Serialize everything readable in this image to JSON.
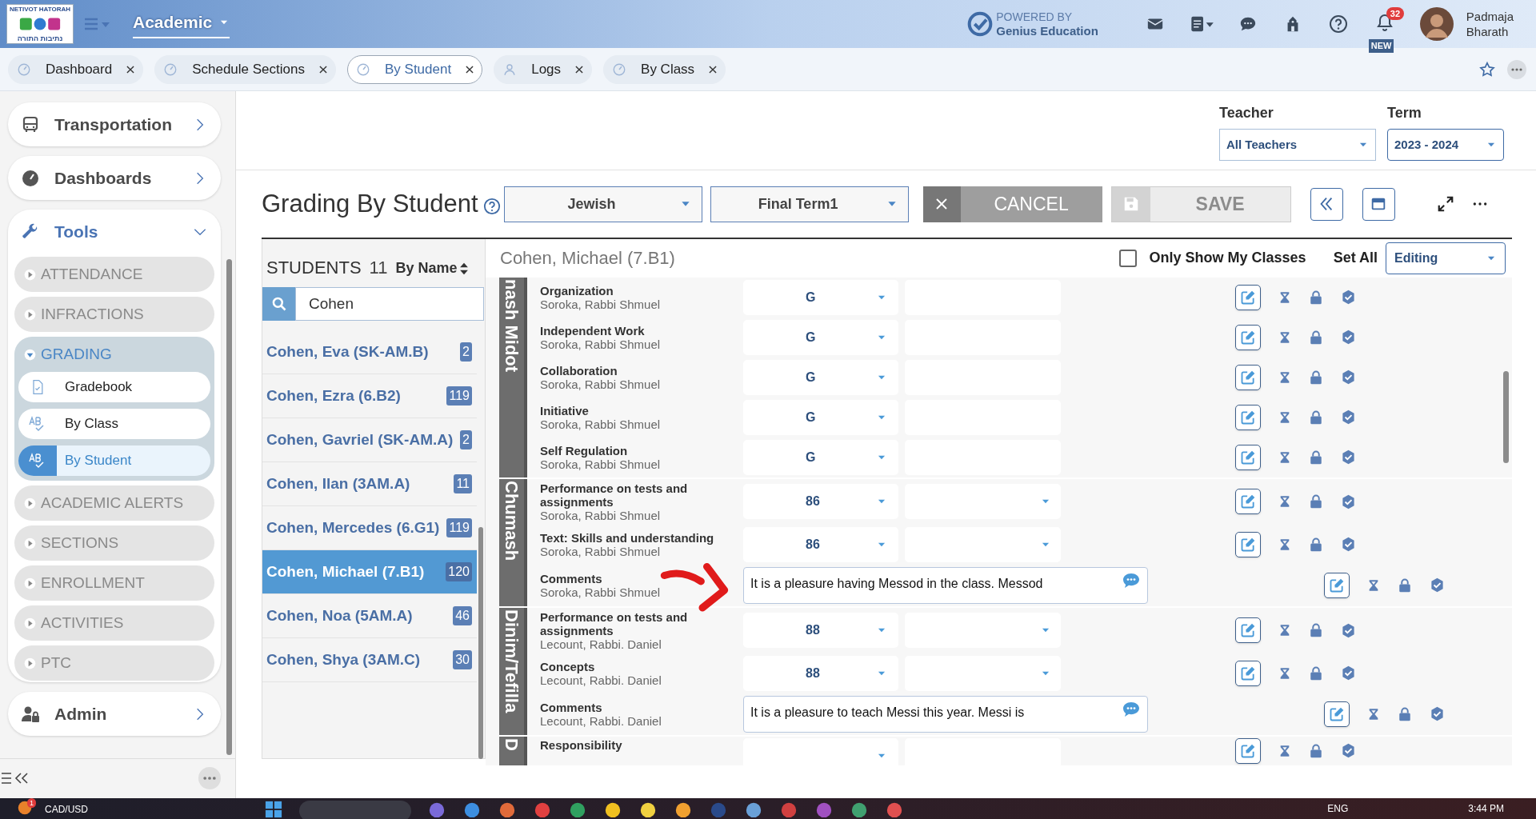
{
  "header": {
    "logo_lines": [
      "NETIVOT HATORAH",
      "נתיבות התורה"
    ],
    "module": "Academic",
    "powered_by": "POWERED BY",
    "brand": "Genius Education",
    "notifications": "32",
    "new_badge": "NEW",
    "user_first": "Padmaja",
    "user_last": "Bharath"
  },
  "tabs": [
    {
      "label": "Dashboard",
      "selected": false
    },
    {
      "label": "Schedule Sections",
      "selected": false
    },
    {
      "label": "By Student",
      "selected": true
    },
    {
      "label": "Logs",
      "selected": false
    },
    {
      "label": "By Class",
      "selected": false
    }
  ],
  "sidebar": {
    "items": [
      {
        "label": "Transportation",
        "expanded": false
      },
      {
        "label": "Dashboards",
        "expanded": false
      },
      {
        "label": "Tools",
        "expanded": true,
        "children": [
          {
            "label": "ATTENDANCE",
            "expanded": false
          },
          {
            "label": "INFRACTIONS",
            "expanded": false
          },
          {
            "label": "GRADING",
            "expanded": true,
            "children": [
              {
                "label": "Gradebook",
                "selected": false
              },
              {
                "label": "By Class",
                "selected": false
              },
              {
                "label": "By Student",
                "selected": true
              }
            ]
          },
          {
            "label": "ACADEMIC ALERTS",
            "expanded": false
          },
          {
            "label": "SECTIONS",
            "expanded": false
          },
          {
            "label": "ENROLLMENT",
            "expanded": false
          },
          {
            "label": "ACTIVITIES",
            "expanded": false
          },
          {
            "label": "PTC",
            "expanded": false
          }
        ]
      },
      {
        "label": "Admin",
        "expanded": false
      }
    ]
  },
  "filters": [
    {
      "label": "Teacher",
      "value": "All Teachers"
    },
    {
      "label": "Term",
      "value": "2023 - 2024"
    }
  ],
  "toolbar": {
    "title": "Grading By Student",
    "selects": [
      "Jewish",
      "Final Term1"
    ],
    "cancel": "CANCEL",
    "save": "SAVE"
  },
  "students": {
    "heading": "STUDENTS",
    "count": "11",
    "sort": "By Name",
    "search": "Cohen",
    "items": [
      {
        "name": "Cohen, Eva (SK-AM.B)",
        "count": "2",
        "selected": false
      },
      {
        "name": "Cohen, Ezra (6.B2)",
        "count": "119",
        "selected": false
      },
      {
        "name": "Cohen, Gavriel (SK-AM.A)",
        "count": "2",
        "selected": false
      },
      {
        "name": "Cohen, Ilan (3AM.A)",
        "count": "11",
        "selected": false
      },
      {
        "name": "Cohen, Mercedes (6.G1)",
        "count": "119",
        "selected": false
      },
      {
        "name": "Cohen, Michael (7.B1)",
        "count": "120",
        "selected": true
      },
      {
        "name": "Cohen, Noa (5AM.A)",
        "count": "46",
        "selected": false
      },
      {
        "name": "Cohen, Shya (3AM.C)",
        "count": "30",
        "selected": false
      }
    ]
  },
  "grades": {
    "student": "Cohen, Michael (7.B1)",
    "only_mine": {
      "label": "Only Show My Classes",
      "checked": false
    },
    "set_all": "Set All",
    "mode": "Editing",
    "sections": [
      {
        "title": "nash Midot",
        "rows": [
          {
            "kind": "grade",
            "subject": "Organization",
            "teacher": "Soroka, Rabbi Shmuel",
            "grade": "G",
            "second_dropdown": false
          },
          {
            "kind": "grade",
            "subject": "Independent Work",
            "teacher": "Soroka, Rabbi Shmuel",
            "grade": "G",
            "second_dropdown": false
          },
          {
            "kind": "grade",
            "subject": "Collaboration",
            "teacher": "Soroka, Rabbi Shmuel",
            "grade": "G",
            "second_dropdown": false
          },
          {
            "kind": "grade",
            "subject": "Initiative",
            "teacher": "Soroka, Rabbi Shmuel",
            "grade": "G",
            "second_dropdown": false
          },
          {
            "kind": "grade",
            "subject": "Self Regulation",
            "teacher": "Soroka, Rabbi Shmuel",
            "grade": "G",
            "second_dropdown": false
          }
        ]
      },
      {
        "title": "Chumash",
        "rows": [
          {
            "kind": "grade",
            "subject": "Performance on tests and assignments",
            "teacher": "Soroka, Rabbi Shmuel",
            "grade": "86",
            "second_dropdown": true
          },
          {
            "kind": "grade",
            "subject": "Text: Skills and understanding",
            "teacher": "Soroka, Rabbi Shmuel",
            "grade": "86",
            "second_dropdown": true
          },
          {
            "kind": "comment",
            "subject": "Comments",
            "teacher": "Soroka, Rabbi Shmuel",
            "text": "It is a pleasure having Messod in the class. Messod"
          }
        ]
      },
      {
        "title": "Dinim/Tefilla",
        "rows": [
          {
            "kind": "grade",
            "subject": "Performance on tests and assignments",
            "teacher": "Lecount, Rabbi. Daniel",
            "grade": "88",
            "second_dropdown": true
          },
          {
            "kind": "grade",
            "subject": "Concepts",
            "teacher": "Lecount, Rabbi. Daniel",
            "grade": "88",
            "second_dropdown": true
          },
          {
            "kind": "comment",
            "subject": "Comments",
            "teacher": "Lecount, Rabbi. Daniel",
            "text": "It is a pleasure to teach Messi this year. Messi is"
          }
        ]
      },
      {
        "title": "D",
        "rows": [
          {
            "kind": "grade",
            "subject": "Responsibility",
            "second_dropdown": false
          }
        ]
      }
    ]
  },
  "taskbar": {
    "ticker": "CAD/USD",
    "badge": "1",
    "language": "ENG",
    "time": "3:44 PM"
  }
}
